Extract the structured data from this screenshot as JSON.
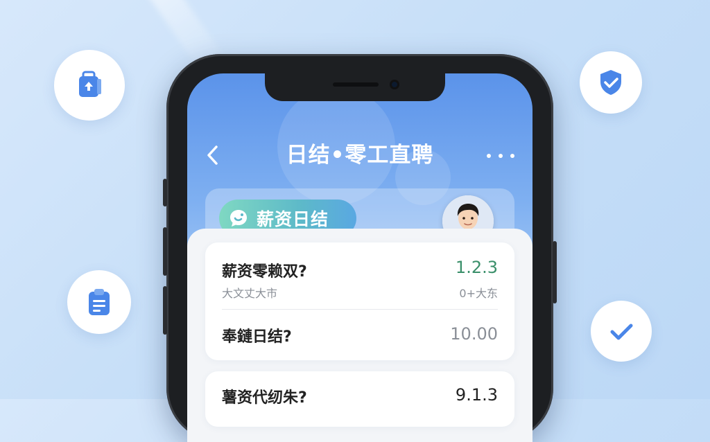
{
  "header": {
    "title": "日结•零工直聘"
  },
  "banner": {
    "pill_label": "薪资日结"
  },
  "list": {
    "item1": {
      "label": "薪资零赖双?",
      "sub": "大文丈大市",
      "value": "1.2.3",
      "sub_right": "0+大东"
    },
    "item2": {
      "label": "奉鏈日结?",
      "value": "10.00"
    },
    "item3": {
      "label": "薯资代纫朱?",
      "value": "9.1.3"
    }
  },
  "colors": {
    "accent_blue": "#5b93ea",
    "green_value": "#3a8f6a",
    "icon_blue": "#4a86e8"
  },
  "icons": [
    "back-chevron-icon",
    "more-icon",
    "bag-upload-icon",
    "clipboard-icon",
    "shield-check-icon",
    "check-icon",
    "chat-bubble-icon"
  ]
}
